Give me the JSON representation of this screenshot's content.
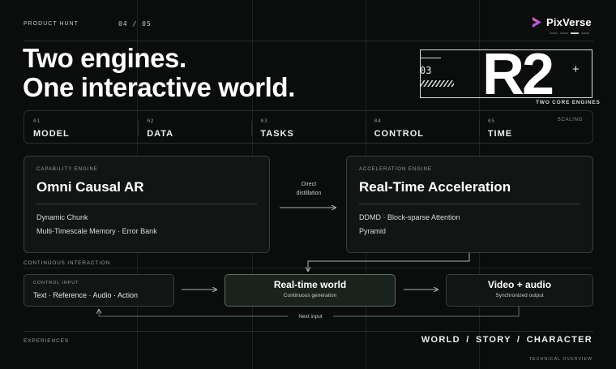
{
  "header": {
    "brand_tag": "PRODUCT HUNT",
    "page_number": "04 / 05",
    "logo_text": "PixVerse"
  },
  "headline": {
    "line1": "Two engines.",
    "line2": "One interactive world."
  },
  "r2_block": {
    "index": "03",
    "model": "R2",
    "plus": "+",
    "caption": "TWO CORE ENGINES"
  },
  "pillars": [
    {
      "num": "01",
      "label": "MODEL"
    },
    {
      "num": "02",
      "label": "DATA"
    },
    {
      "num": "03",
      "label": "TASKS"
    },
    {
      "num": "04",
      "label": "CONTROL"
    },
    {
      "num": "05",
      "label": "TIME"
    }
  ],
  "pillars_tag": "SCALING",
  "capability_engine": {
    "tag": "CAPABILITY ENGINE",
    "title": "Omni Causal AR",
    "line1": "Dynamic Chunk",
    "line2": "Multi-Timescale Memory  ·  Error Bank"
  },
  "distillation_label": {
    "line1": "Direct",
    "line2": "distillation"
  },
  "acceleration_engine": {
    "tag": "ACCELERATION ENGINE",
    "title": "Real-Time Acceleration",
    "line1": "DDMD  ·  Block-sparse Attention",
    "line2": "Pyramid"
  },
  "continuous_label": "CONTINUOUS INTERACTION",
  "control_input": {
    "tag": "CONTROL INPUT",
    "text": "Text · Reference · Audio · Action"
  },
  "realtime_world": {
    "title": "Real-time world",
    "subtitle": "Continuous generation"
  },
  "video_audio": {
    "title": "Video + audio",
    "subtitle": "Synchronized output"
  },
  "next_input_label": "Next input",
  "footer": {
    "experiences_label": "EXPERIENCES",
    "experiences": "WORLD  /  STORY  /  CHARACTER",
    "technical_label": "TECHNICAL OVERVIEW"
  },
  "colors": {
    "background": "#0b0c0c",
    "accent_green": "#5a6b5f",
    "logo_pink": "#e04fd0",
    "logo_purple": "#7a4dff"
  }
}
